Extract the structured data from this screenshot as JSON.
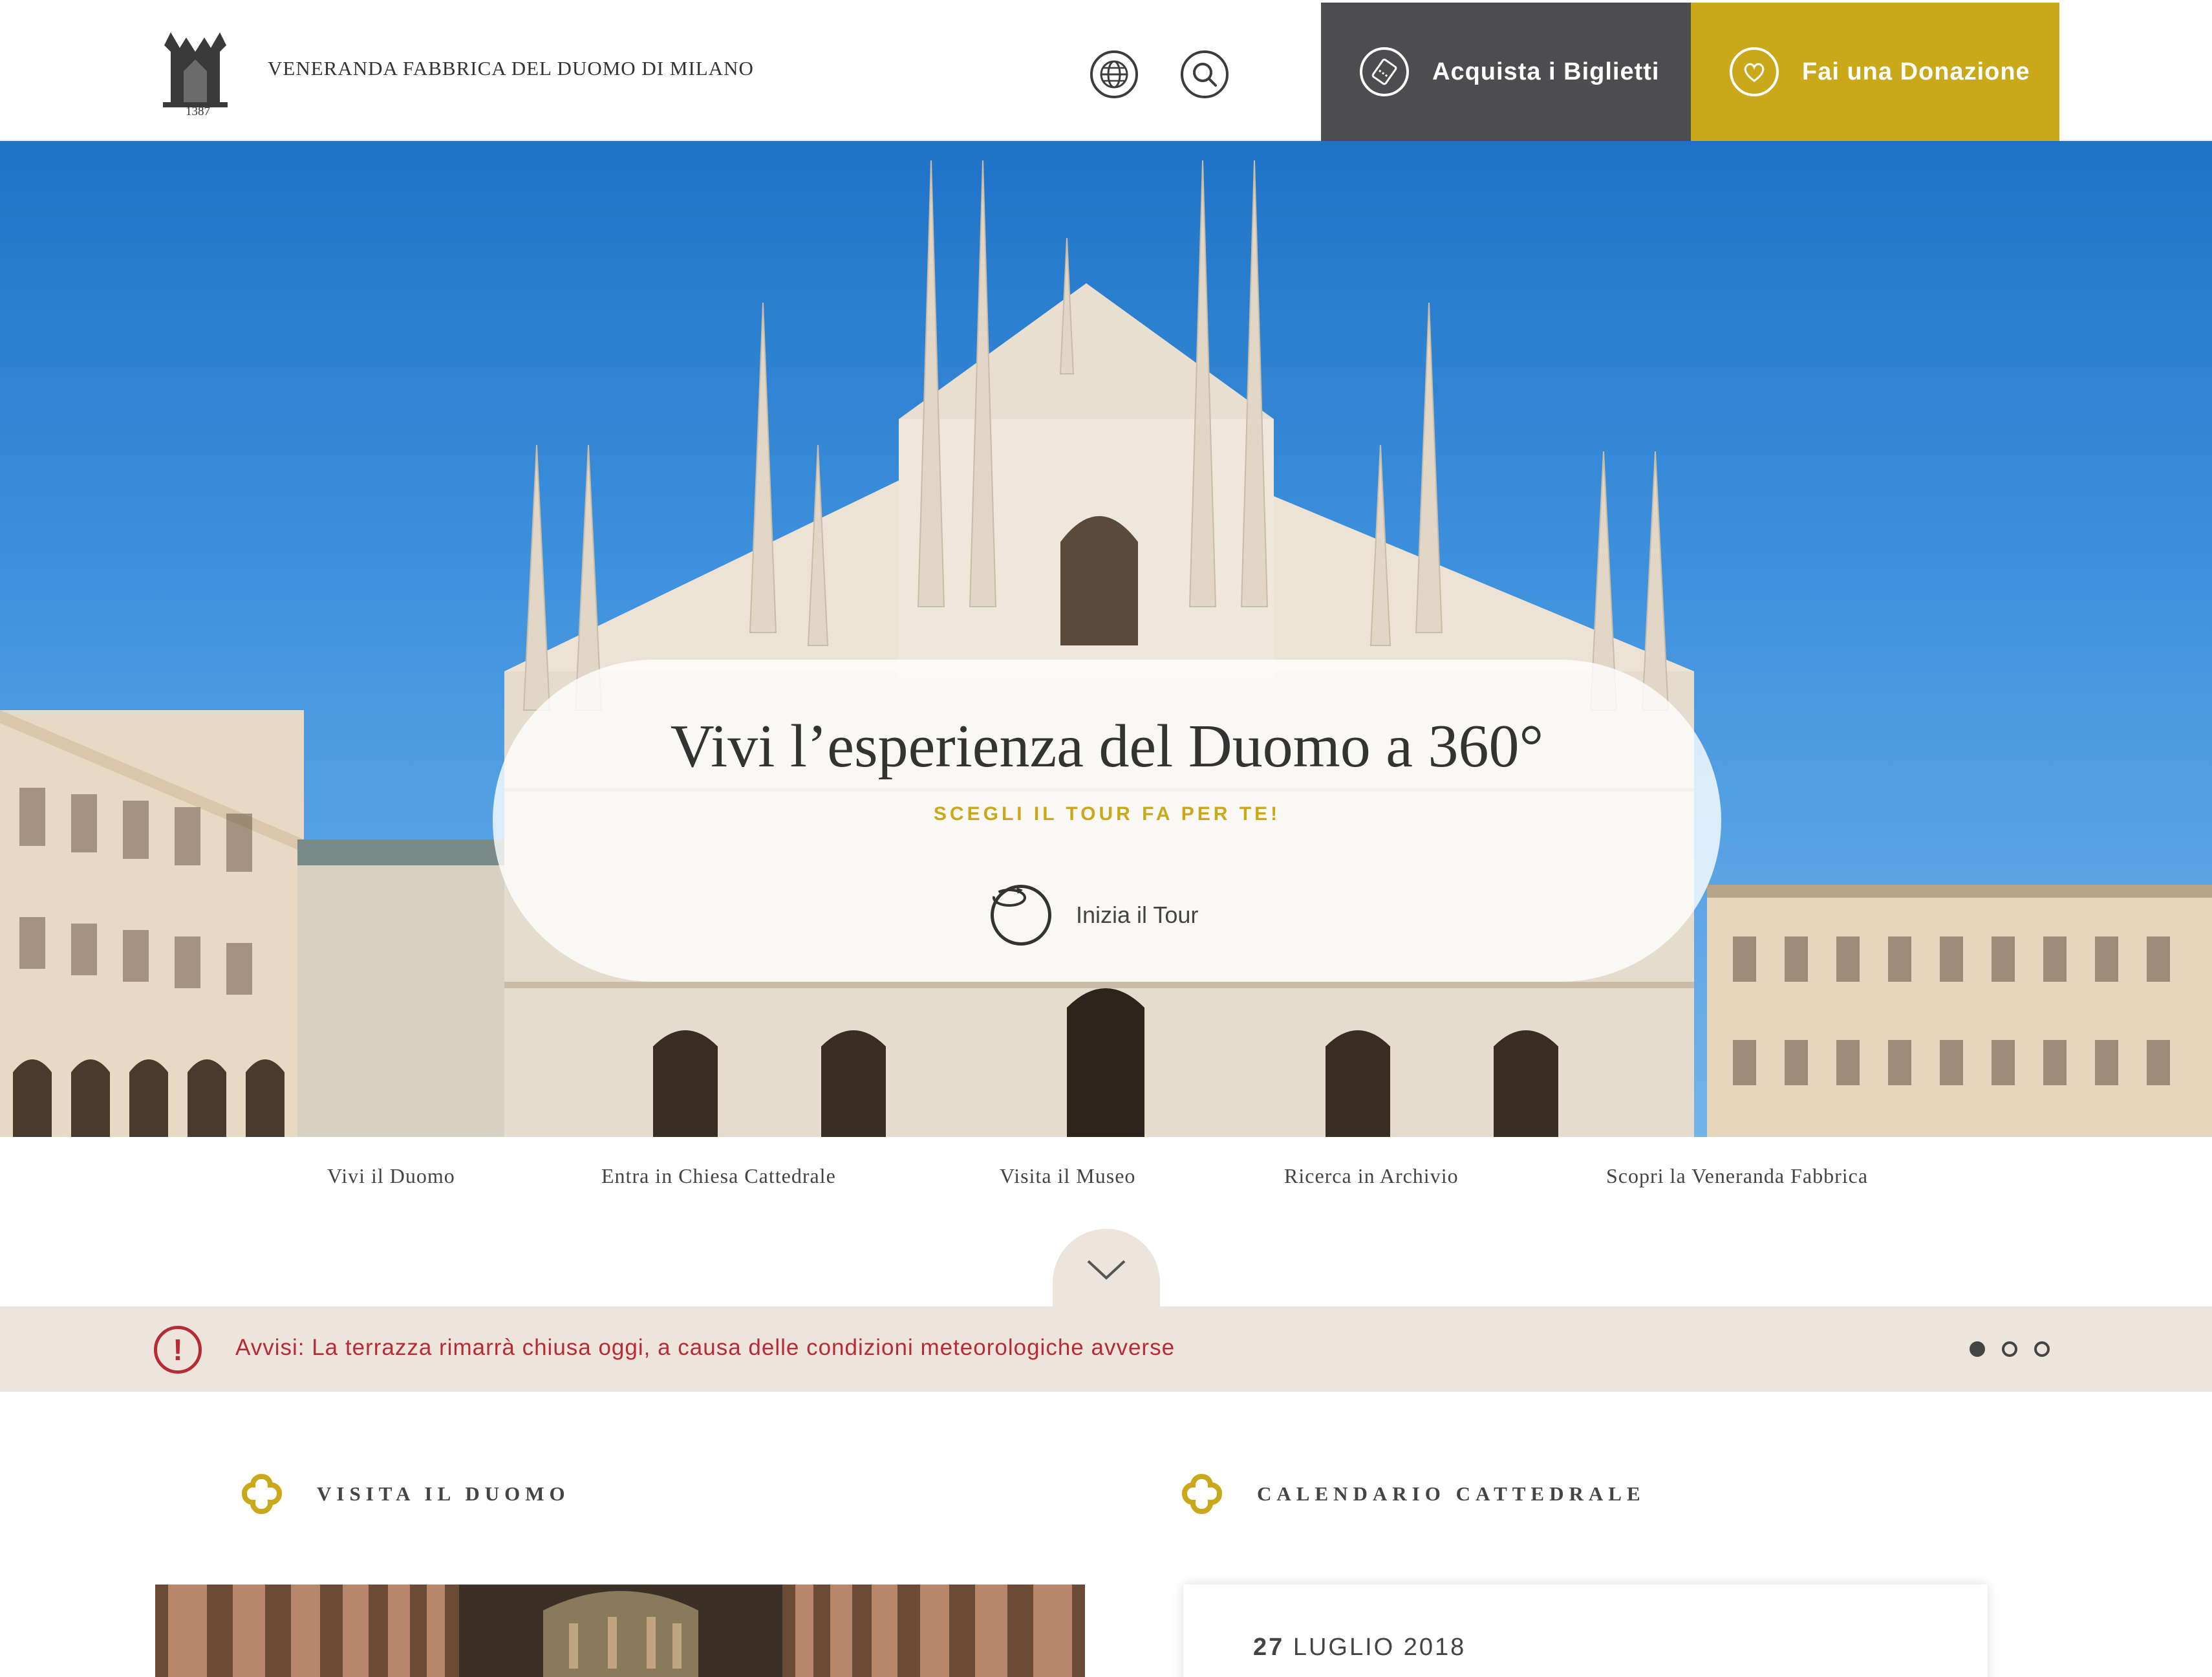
{
  "header": {
    "brand_name": "VENERANDA FABBRICA DEL DUOMO DI MILANO",
    "logo_year": "1387",
    "language_icon": "globe-icon",
    "search_icon": "search-icon",
    "tickets_label": "Acquista i Biglietti",
    "tickets_icon": "ticket-icon",
    "donate_label": "Fai una Donazione",
    "donate_icon": "heart-icon"
  },
  "hero": {
    "title": "Vivi l’esperienza del Duomo a 360°",
    "subtitle": "SCEGLI IL TOUR FA PER TE!",
    "cta_label": "Inizia il Tour",
    "cta_icon": "rotate-360-icon"
  },
  "nav": {
    "items": [
      "Vivi il Duomo",
      "Entra in Chiesa Cattedrale",
      "Visita il Museo",
      "Ricerca in Archivio",
      "Scopri la Veneranda Fabbrica"
    ],
    "scroll_icon": "chevron-down-icon"
  },
  "alert": {
    "icon": "alert-icon",
    "text": "Avvisi: La terrazza rimarrà chiusa oggi, a causa delle condizioni meteorologiche avverse",
    "slide_count": 3,
    "active_slide": 1
  },
  "sections": {
    "visit_title": "VISITA IL DUOMO",
    "calendar_title": "CALENDARIO CATTEDRALE",
    "calendar_day": "27",
    "calendar_month_year": "LUGLIO 2018"
  },
  "colors": {
    "gold": "#c9a81a",
    "dark_gray": "#4d4d4f",
    "alert_red": "#b72b36",
    "alert_bg": "#ede5dc"
  }
}
